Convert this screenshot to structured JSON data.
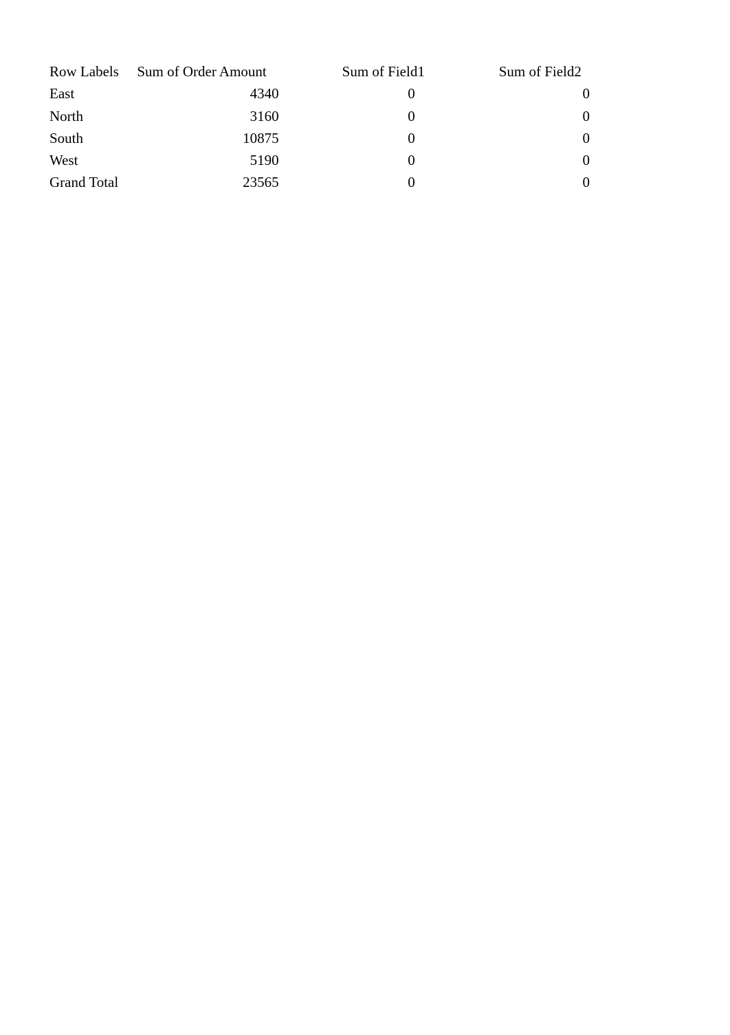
{
  "table": {
    "headers": {
      "row_labels": "Row Labels",
      "sum_order_amount": "Sum of Order Amount",
      "sum_field1": "Sum of Field1",
      "sum_field2": "Sum of Field2"
    },
    "rows": [
      {
        "label": "East",
        "amount": "4340",
        "field1": "0",
        "field2": "0"
      },
      {
        "label": "North",
        "amount": "3160",
        "field1": "0",
        "field2": "0"
      },
      {
        "label": "South",
        "amount": "10875",
        "field1": "0",
        "field2": "0"
      },
      {
        "label": "West",
        "amount": "5190",
        "field1": "0",
        "field2": "0"
      },
      {
        "label": "Grand Total",
        "amount": "23565",
        "field1": "0",
        "field2": "0"
      }
    ]
  }
}
